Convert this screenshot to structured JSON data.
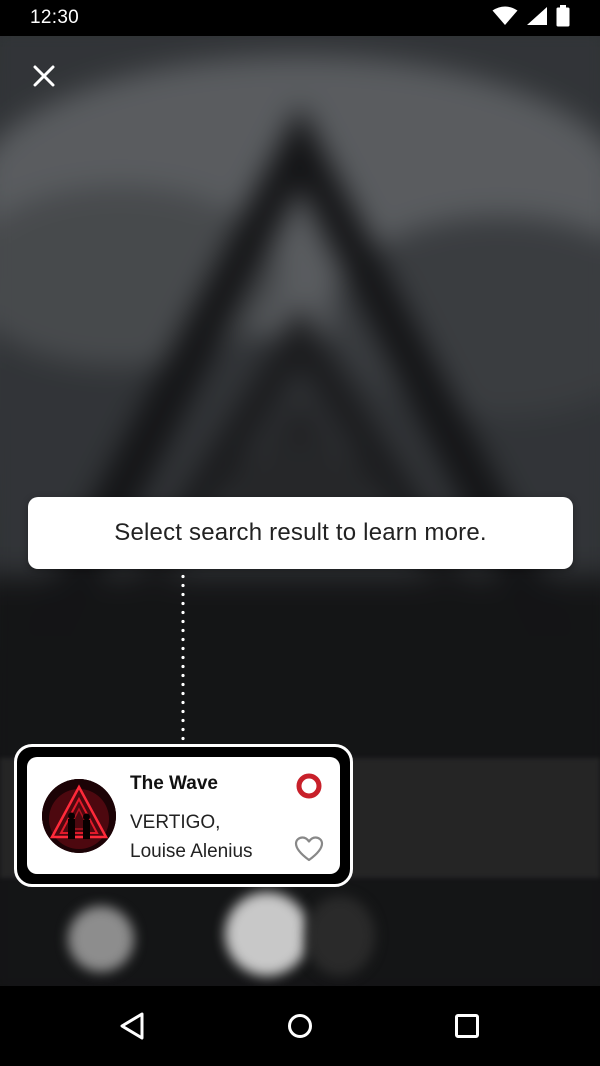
{
  "status_bar": {
    "time": "12:30",
    "icons": [
      "wifi-icon",
      "cellular-signal-icon",
      "battery-icon"
    ]
  },
  "overlay": {
    "close_icon": "close-icon",
    "tooltip_text": "Select search result to learn more."
  },
  "result_card": {
    "title": "The Wave",
    "artist_line1": "VERTIGO,",
    "artist_line2": "Louise Alenius",
    "record_icon": "record-icon",
    "favorite_icon": "heart-icon",
    "accent_color": "#c8202a"
  },
  "nav_bar": {
    "back_icon": "back-icon",
    "home_icon": "home-icon",
    "recents_icon": "recents-icon"
  }
}
